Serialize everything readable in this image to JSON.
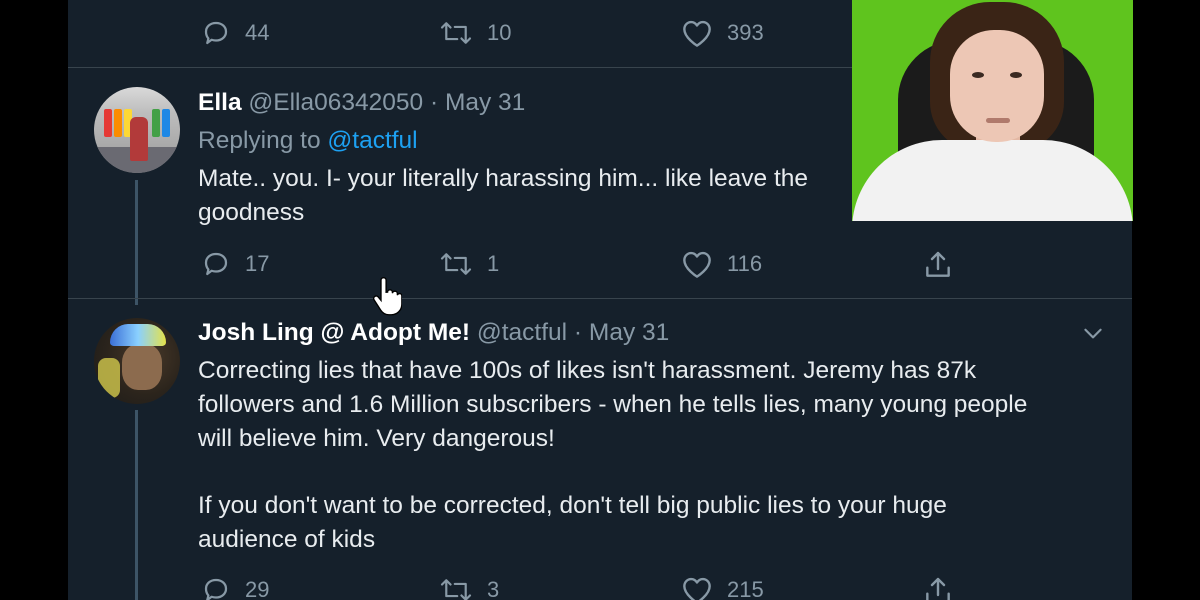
{
  "prev_tweet": {
    "actions": {
      "replies": "44",
      "retweets": "10",
      "likes": "393"
    }
  },
  "ella_tweet": {
    "name": "Ella",
    "handle": "@Ella06342050",
    "date": "May 31",
    "replying_prefix": "Replying to",
    "replying_to": "@tactful",
    "text_line1": "Mate.. you. I- your literally harassing him... like leave the",
    "text_line2": "goodness",
    "actions": {
      "replies": "17",
      "retweets": "1",
      "likes": "116"
    }
  },
  "josh_tweet": {
    "name": "Josh Ling @ Adopt Me!",
    "handle": "@tactful",
    "date": "May 31",
    "lines": [
      "Correcting lies that have 100s of likes isn't harassment. Jeremy has 87k",
      "followers and 1.6 Million subscribers - when he tells lies, many young people",
      "will believe him. Very dangerous!",
      "If you don't want to be corrected, don't tell big public lies to your huge",
      "audience of kids"
    ],
    "actions": {
      "replies": "29",
      "retweets": "3",
      "likes": "215"
    }
  },
  "separator": "·",
  "colors": {
    "background": "#15202b",
    "text": "#e8ecef",
    "muted": "#8899a6",
    "link": "#1da1f2",
    "border": "#38444d",
    "webcam_bg": "#5fc41e"
  },
  "icons": [
    "reply-icon",
    "retweet-icon",
    "like-icon",
    "share-icon",
    "chevron-down-icon",
    "hand-cursor-icon"
  ]
}
